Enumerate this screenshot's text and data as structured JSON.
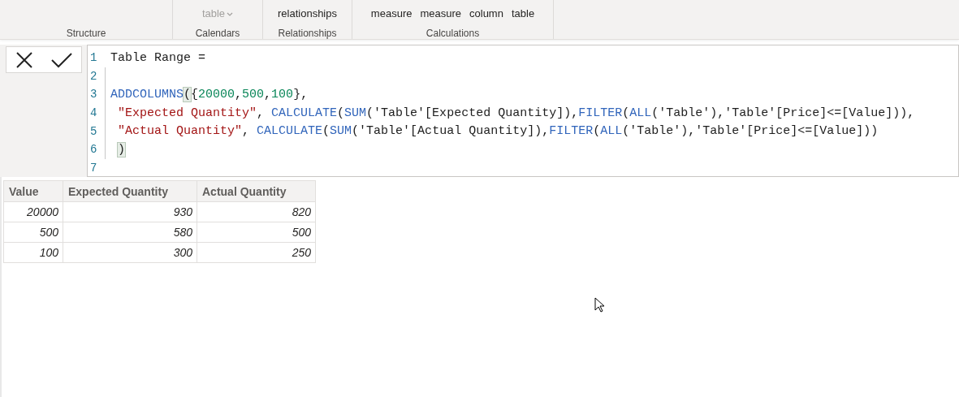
{
  "ribbon": {
    "groups": [
      {
        "label": "Structure"
      },
      {
        "label": "Calendars",
        "buttons": [
          {
            "text": "table",
            "dropdown": true,
            "disabled": true
          }
        ]
      },
      {
        "label": "Relationships",
        "buttons": [
          {
            "text": "relationships",
            "dropdown": false,
            "disabled": false
          }
        ]
      },
      {
        "label": "Calculations",
        "buttons": [
          {
            "text": "measure",
            "dropdown": false,
            "disabled": false
          },
          {
            "text": "measure",
            "dropdown": false,
            "disabled": false
          },
          {
            "text": "column",
            "dropdown": false,
            "disabled": false
          },
          {
            "text": "table",
            "dropdown": false,
            "disabled": false
          }
        ]
      }
    ]
  },
  "formula_bar": {
    "lines": [
      {
        "number": "1",
        "tokens": [
          {
            "text": "Table Range =",
            "kind": "plain"
          }
        ]
      },
      {
        "number": "2"
      },
      {
        "number": "3",
        "tokens": [
          {
            "text": "ADDCOLUMNS",
            "kind": "func"
          },
          {
            "text": "(",
            "kind": "match"
          },
          {
            "text": "{",
            "kind": "plain"
          },
          {
            "text": "20000",
            "kind": "num"
          },
          {
            "text": ",",
            "kind": "plain"
          },
          {
            "text": "500",
            "kind": "num"
          },
          {
            "text": ",",
            "kind": "plain"
          },
          {
            "text": "100",
            "kind": "num"
          },
          {
            "text": "},",
            "kind": "plain"
          }
        ]
      },
      {
        "number": "4",
        "tokens": [
          {
            "text": " \"Expected Quantity\"",
            "kind": "str"
          },
          {
            "text": ", ",
            "kind": "plain"
          },
          {
            "text": "CALCULATE",
            "kind": "func"
          },
          {
            "text": "(",
            "kind": "plain"
          },
          {
            "text": "SUM",
            "kind": "func"
          },
          {
            "text": "('Table'[Expected Quantity]),",
            "kind": "plain"
          },
          {
            "text": "FILTER",
            "kind": "func"
          },
          {
            "text": "(",
            "kind": "plain"
          },
          {
            "text": "ALL",
            "kind": "func"
          },
          {
            "text": "('Table'),'Table'[Price]<=[Value])),",
            "kind": "plain"
          }
        ]
      },
      {
        "number": "5",
        "tokens": [
          {
            "text": " \"Actual Quantity\"",
            "kind": "str"
          },
          {
            "text": ", ",
            "kind": "plain"
          },
          {
            "text": "CALCULATE",
            "kind": "func"
          },
          {
            "text": "(",
            "kind": "plain"
          },
          {
            "text": "SUM",
            "kind": "func"
          },
          {
            "text": "('Table'[Actual Quantity]),",
            "kind": "plain"
          },
          {
            "text": "FILTER",
            "kind": "func"
          },
          {
            "text": "(",
            "kind": "plain"
          },
          {
            "text": "ALL",
            "kind": "func"
          },
          {
            "text": "('Table'),'Table'[Price]<=[Value]))",
            "kind": "plain"
          }
        ]
      },
      {
        "number": "6",
        "tokens": [
          {
            "text": " )",
            "kind": "match"
          }
        ]
      },
      {
        "number": "7"
      }
    ]
  },
  "table": {
    "columns": [
      "Value",
      "Expected Quantity",
      "Actual Quantity"
    ],
    "rows": [
      [
        "20000",
        "930",
        "820"
      ],
      [
        "500",
        "580",
        "500"
      ],
      [
        "100",
        "300",
        "250"
      ]
    ]
  }
}
